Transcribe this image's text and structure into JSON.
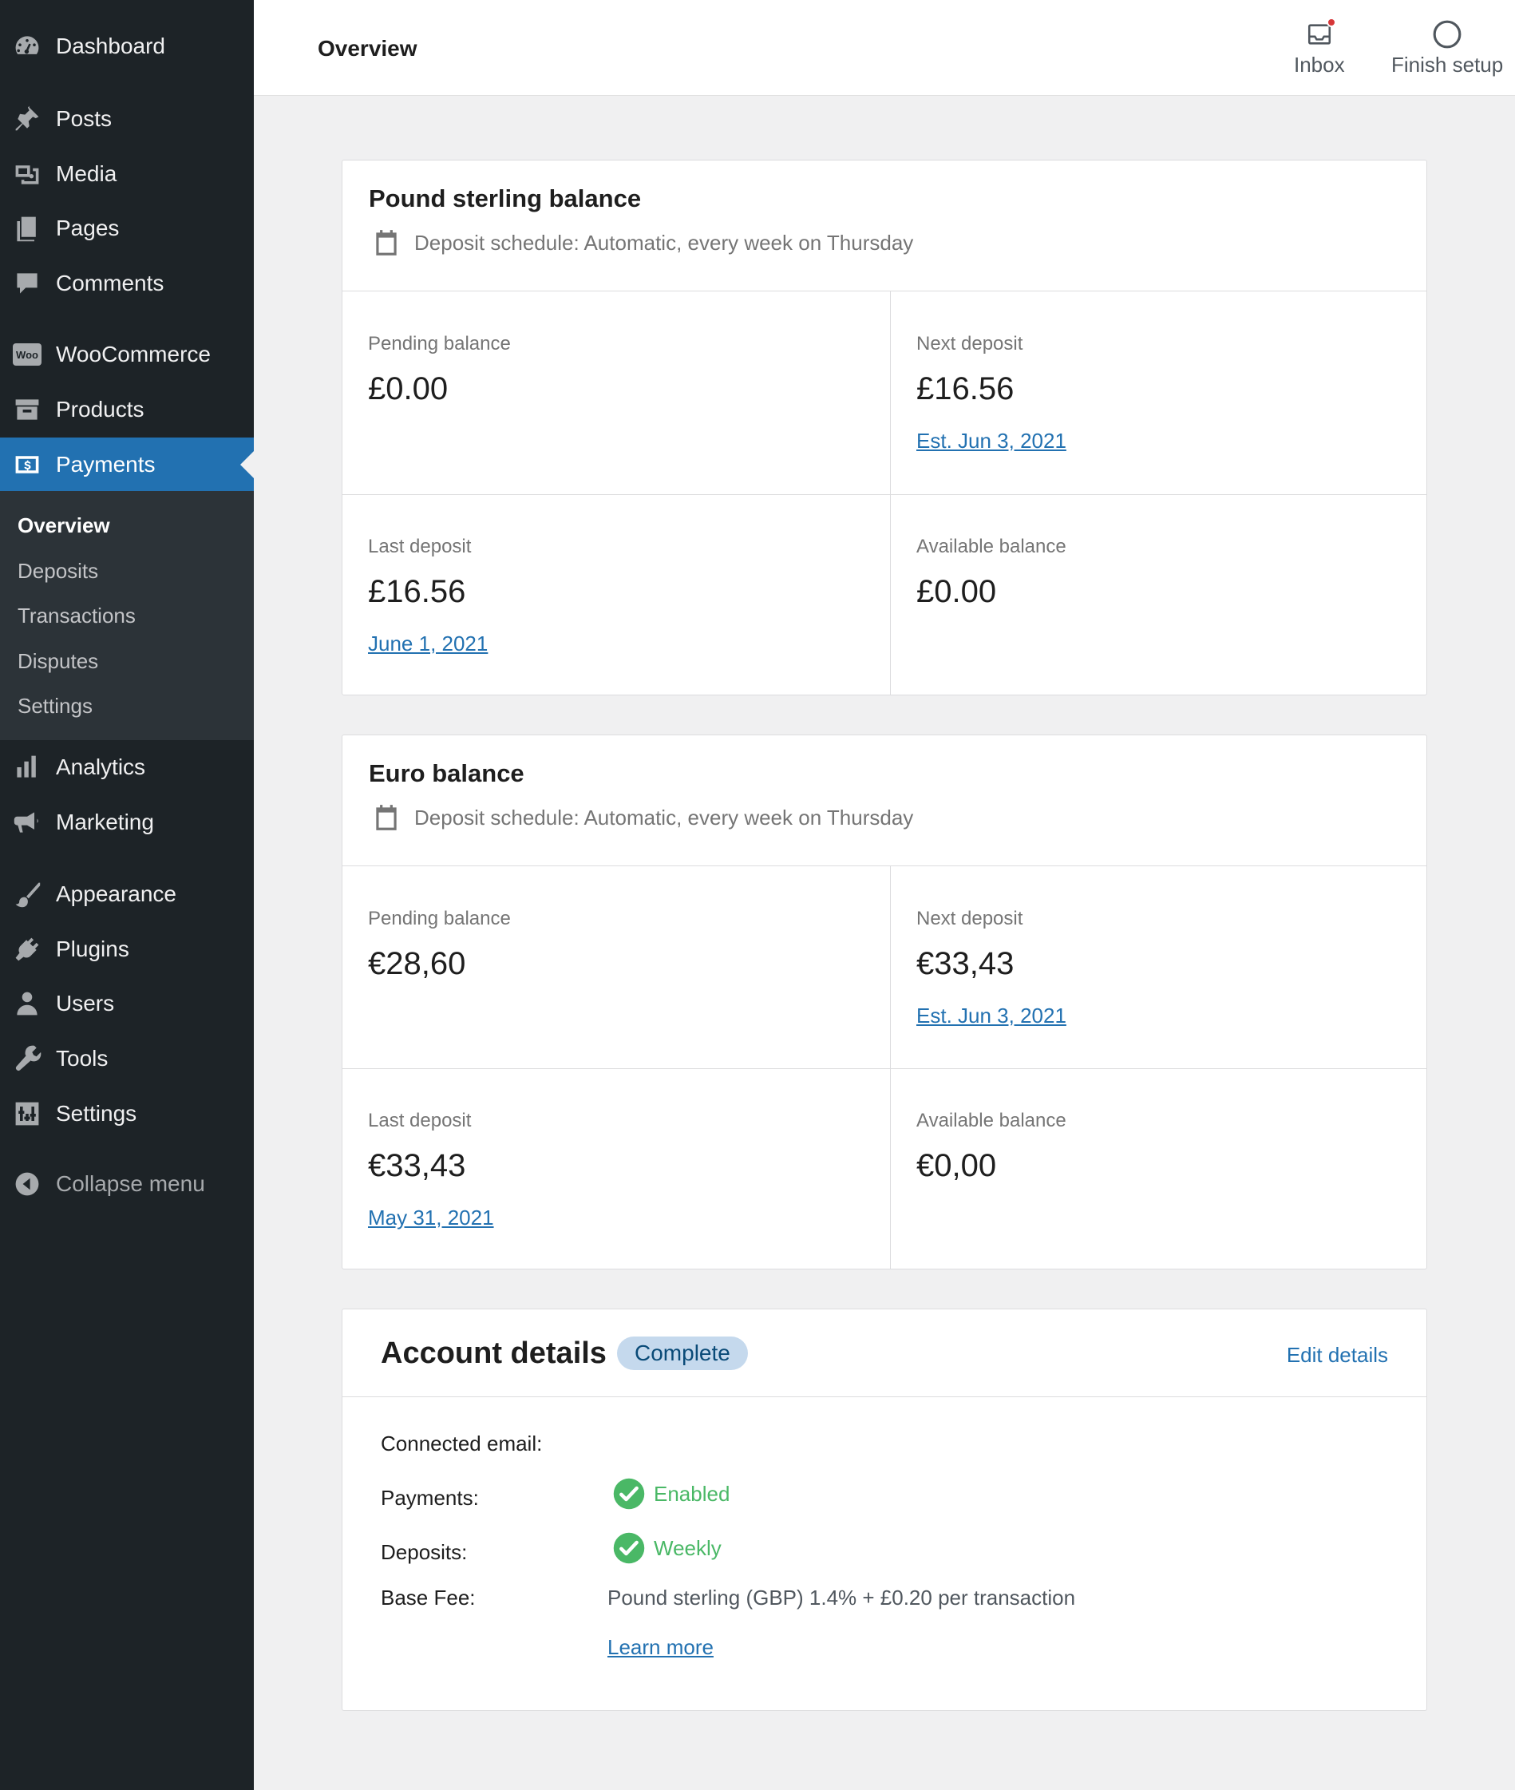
{
  "sidebar": {
    "items": [
      {
        "label": "Dashboard",
        "icon": "dashboard-icon"
      },
      {
        "label": "Posts",
        "icon": "pin-icon"
      },
      {
        "label": "Media",
        "icon": "media-icon"
      },
      {
        "label": "Pages",
        "icon": "pages-icon"
      },
      {
        "label": "Comments",
        "icon": "comment-icon"
      },
      {
        "label": "WooCommerce",
        "icon": "woo-icon"
      },
      {
        "label": "Products",
        "icon": "archive-icon"
      },
      {
        "label": "Payments",
        "icon": "dollar-icon"
      },
      {
        "label": "Analytics",
        "icon": "bar-chart-icon"
      },
      {
        "label": "Marketing",
        "icon": "megaphone-icon"
      },
      {
        "label": "Appearance",
        "icon": "brush-icon"
      },
      {
        "label": "Plugins",
        "icon": "plug-icon"
      },
      {
        "label": "Users",
        "icon": "user-icon"
      },
      {
        "label": "Tools",
        "icon": "wrench-icon"
      },
      {
        "label": "Settings",
        "icon": "sliders-icon"
      }
    ],
    "submenu": [
      "Overview",
      "Deposits",
      "Transactions",
      "Disputes",
      "Settings"
    ],
    "collapse_label": "Collapse menu",
    "woo_icon_text": "Woo"
  },
  "header": {
    "title": "Overview",
    "inbox_label": "Inbox",
    "finish_setup_label": "Finish setup"
  },
  "gbp": {
    "title": "Pound sterling balance",
    "schedule": "Deposit schedule: Automatic, every week on Thursday",
    "pending_label": "Pending balance",
    "pending_value": "£0.00",
    "next_label": "Next deposit",
    "next_value": "£16.56",
    "next_date": "Est. Jun 3, 2021",
    "last_label": "Last deposit",
    "last_value": "£16.56",
    "last_date": "June 1, 2021",
    "available_label": "Available balance",
    "available_value": "£0.00"
  },
  "eur": {
    "title": "Euro balance",
    "schedule": "Deposit schedule: Automatic, every week on Thursday",
    "pending_label": "Pending balance",
    "pending_value": "€28,60",
    "next_label": "Next deposit",
    "next_value": "€33,43",
    "next_date": "Est. Jun 3, 2021",
    "last_label": "Last deposit",
    "last_value": "€33,43",
    "last_date": "May 31, 2021",
    "available_label": "Available balance",
    "available_value": "€0,00"
  },
  "account": {
    "title": "Account details",
    "badge": "Complete",
    "edit_label": "Edit details",
    "email_label": "Connected email:",
    "payments_label": "Payments:",
    "payments_value": "Enabled",
    "deposits_label": "Deposits:",
    "deposits_value": "Weekly",
    "fee_label": "Base Fee:",
    "fee_value": "Pound sterling (GBP) 1.4% + £0.20 per transaction",
    "learn_more": "Learn more"
  },
  "colors": {
    "sidebar_bg": "#1d2327",
    "accent": "#2271b1",
    "success": "#4ab866",
    "badge_bg": "#c5d9ed"
  }
}
